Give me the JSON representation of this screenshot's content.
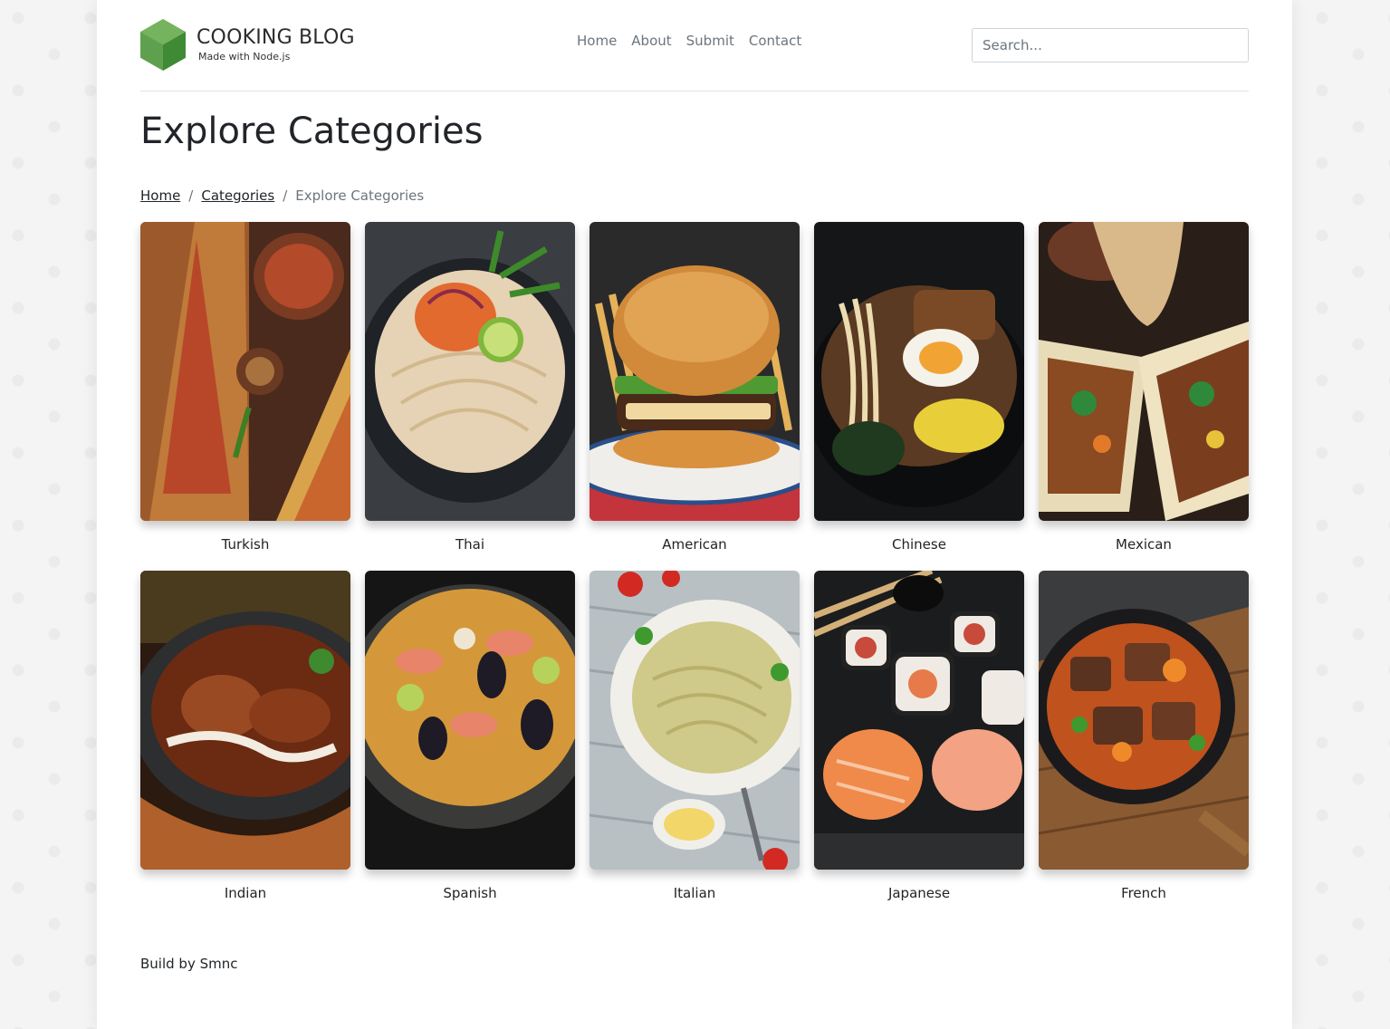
{
  "brand": {
    "title": "COOKING BLOG",
    "subtitle": "Made with Node.js"
  },
  "nav": {
    "items": [
      "Home",
      "About",
      "Submit",
      "Contact"
    ]
  },
  "search": {
    "placeholder": "Search..."
  },
  "page_title": "Explore Categories",
  "breadcrumb": {
    "home": "Home",
    "categories": "Categories",
    "current": "Explore Categories"
  },
  "categories": [
    {
      "name": "Turkish",
      "image": "turkish-food-photo"
    },
    {
      "name": "Thai",
      "image": "thai-food-photo"
    },
    {
      "name": "American",
      "image": "american-food-photo"
    },
    {
      "name": "Chinese",
      "image": "chinese-food-photo"
    },
    {
      "name": "Mexican",
      "image": "mexican-food-photo"
    },
    {
      "name": "Indian",
      "image": "indian-food-photo"
    },
    {
      "name": "Spanish",
      "image": "spanish-food-photo"
    },
    {
      "name": "Italian",
      "image": "italian-food-photo"
    },
    {
      "name": "Japanese",
      "image": "japanese-food-photo"
    },
    {
      "name": "French",
      "image": "french-food-photo"
    }
  ],
  "footer": {
    "text": "Build by Smnc"
  },
  "colors": {
    "brand_green": "#5fa04e",
    "text": "#212529",
    "muted": "#6c757d",
    "border": "#e2e2e2"
  }
}
